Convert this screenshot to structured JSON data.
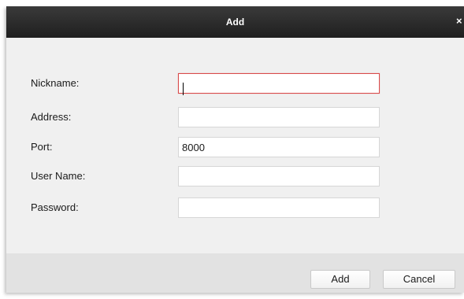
{
  "dialog": {
    "title": "Add",
    "close_label": "×"
  },
  "form": {
    "nickname": {
      "label": "Nickname:",
      "value": ""
    },
    "address": {
      "label": "Address:",
      "value": ""
    },
    "port": {
      "label": "Port:",
      "value": "8000"
    },
    "username": {
      "label": "User Name:",
      "value": ""
    },
    "password": {
      "label": "Password:",
      "value": ""
    }
  },
  "footer": {
    "add_label": "Add",
    "cancel_label": "Cancel"
  },
  "colors": {
    "titlebar": "#2b2b2b",
    "focus_border": "#d84a4a",
    "dialog_bg": "#f0f0f0",
    "footer_bg": "#e2e2e2"
  }
}
